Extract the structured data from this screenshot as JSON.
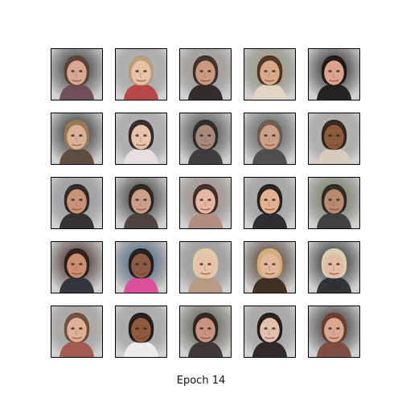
{
  "figure": {
    "caption": "Epoch 14",
    "rows": 5,
    "cols": 5
  },
  "samples": [
    {
      "bg": "#3b3436",
      "hair": "#5a4036",
      "skin": "#d9a894",
      "shirt": "#6a4a55"
    },
    {
      "bg": "#e6eef2",
      "hair": "#b79a7a",
      "skin": "#e7c2a4",
      "shirt": "#b84040"
    },
    {
      "bg": "#cfc5bb",
      "hair": "#3a2b22",
      "skin": "#c99a80",
      "shirt": "#2d2424"
    },
    {
      "bg": "#c8c79d",
      "hair": "#4a2c20",
      "skin": "#d8a98a",
      "shirt": "#e3d7c4"
    },
    {
      "bg": "#2a2322",
      "hair": "#1c1513",
      "skin": "#d9a58f",
      "shirt": "#1d1a1a"
    },
    {
      "bg": "#2c2826",
      "hair": "#9a7a55",
      "skin": "#d9b197",
      "shirt": "#5a4a3f"
    },
    {
      "bg": "#f4eef0",
      "hair": "#2d2321",
      "skin": "#e8c3ad",
      "shirt": "#e9e0e2"
    },
    {
      "bg": "#51504e",
      "hair": "#2c2725",
      "skin": "#a88a7a",
      "shirt": "#3a3838"
    },
    {
      "bg": "#6e7573",
      "hair": "#6a5a4d",
      "skin": "#caa186",
      "shirt": "#4a4a48"
    },
    {
      "bg": "#f3ede6",
      "hair": "#2a1d15",
      "skin": "#8c5a3c",
      "shirt": "#d8ccbf"
    },
    {
      "bg": "#c4cad4",
      "hair": "#2a211c",
      "skin": "#c69478",
      "shirt": "#2f2a2b"
    },
    {
      "bg": "#3a3f37",
      "hair": "#2a201b",
      "skin": "#caa08a",
      "shirt": "#4a3f38"
    },
    {
      "bg": "#d6b8a8",
      "hair": "#3a2820",
      "skin": "#e3b7a4",
      "shirt": "#b28b7c"
    },
    {
      "bg": "#d8d6d4",
      "hair": "#1e1816",
      "skin": "#e0b292",
      "shirt": "#27262a"
    },
    {
      "bg": "#8ea06e",
      "hair": "#2a2220",
      "skin": "#b88a6f",
      "shirt": "#3a3a3c"
    },
    {
      "bg": "#4a1e14",
      "hair": "#2a1c16",
      "skin": "#c98f74",
      "shirt": "#2d3038"
    },
    {
      "bg": "#4b78b3",
      "hair": "#1d1816",
      "skin": "#8a5a44",
      "shirt": "#e04a9a"
    },
    {
      "bg": "#c9c3bd",
      "hair": "#e0cfa6",
      "skin": "#e6c2a6",
      "shirt": "#b79a85"
    },
    {
      "bg": "#5c3a1e",
      "hair": "#d6b27a",
      "skin": "#e1b699",
      "shirt": "#3a2a1f"
    },
    {
      "bg": "#1f2124",
      "hair": "#e2d4b0",
      "skin": "#e2bca5",
      "shirt": "#2a2c30"
    },
    {
      "bg": "#e8dcd4",
      "hair": "#6a4a3a",
      "skin": "#e0b096",
      "shirt": "#a3564a"
    },
    {
      "bg": "#e7e4ea",
      "hair": "#1a1412",
      "skin": "#8e5a3e",
      "shirt": "#f1eef1"
    },
    {
      "bg": "#6f6a4f",
      "hair": "#2a201c",
      "skin": "#c89480",
      "shirt": "#3a3030"
    },
    {
      "bg": "#dedcdb",
      "hair": "#1a1412",
      "skin": "#e2c0ad",
      "shirt": "#2a2222"
    },
    {
      "bg": "#3a2f2e",
      "hair": "#6a3a28",
      "skin": "#d9a892",
      "shirt": "#7a4a3c"
    }
  ]
}
